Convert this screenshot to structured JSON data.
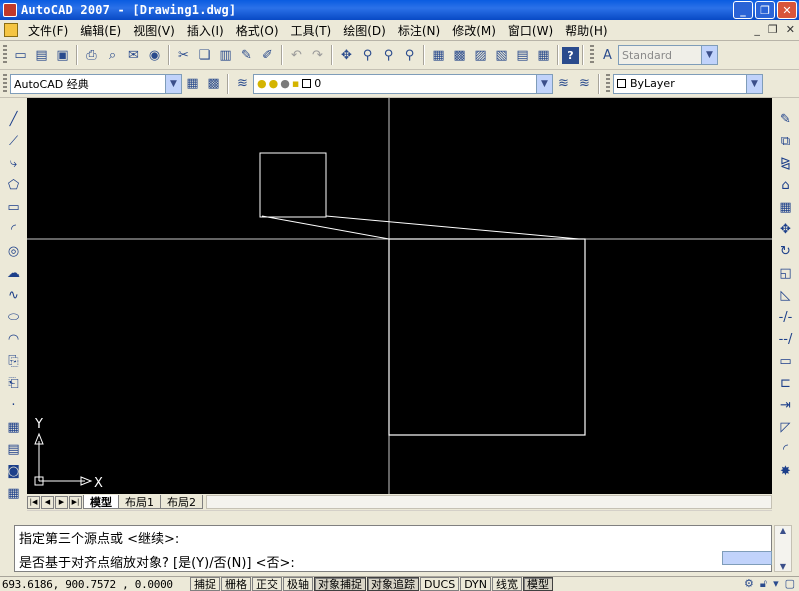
{
  "window": {
    "title": "AutoCAD 2007 - [Drawing1.dwg]",
    "buttons": {
      "minimize": "_",
      "restore": "❐",
      "close": "✕"
    }
  },
  "menu": {
    "items": [
      "文件(F)",
      "编辑(E)",
      "视图(V)",
      "插入(I)",
      "格式(O)",
      "工具(T)",
      "绘图(D)",
      "标注(N)",
      "修改(M)",
      "窗口(W)",
      "帮助(H)"
    ],
    "doc_buttons": {
      "minimize": "_",
      "restore": "❐",
      "close": "✕"
    }
  },
  "toolbar1": {
    "text_style": "Standard"
  },
  "toolbar2": {
    "workspace": "AutoCAD 经典",
    "layer_name": "0",
    "color": "ByLayer"
  },
  "layout_tabs": [
    "模型",
    "布局1",
    "布局2"
  ],
  "canvas": {
    "ucs_x_label": "X",
    "ucs_y_label": "Y"
  },
  "command": {
    "line1": "指定第三个源点或 <继续>:",
    "line2": "是否基于对齐点缩放对象? [是(Y)/否(N)] <否>:"
  },
  "status": {
    "coordinates": "693.6186,  900.7572 , 0.0000",
    "toggles": [
      {
        "label": "捕捉",
        "on": false
      },
      {
        "label": "栅格",
        "on": false
      },
      {
        "label": "正交",
        "on": false
      },
      {
        "label": "极轴",
        "on": false
      },
      {
        "label": "对象捕捉",
        "on": true
      },
      {
        "label": "对象追踪",
        "on": true
      },
      {
        "label": "DUCS",
        "on": false
      },
      {
        "label": "DYN",
        "on": false
      },
      {
        "label": "线宽",
        "on": false
      },
      {
        "label": "模型",
        "on": true
      }
    ]
  },
  "colors": {
    "canvas_bg": "#000000",
    "geometry": "#ffffff",
    "crosshair": "#c8c8c8",
    "titlebar": "#0a5ce0"
  }
}
